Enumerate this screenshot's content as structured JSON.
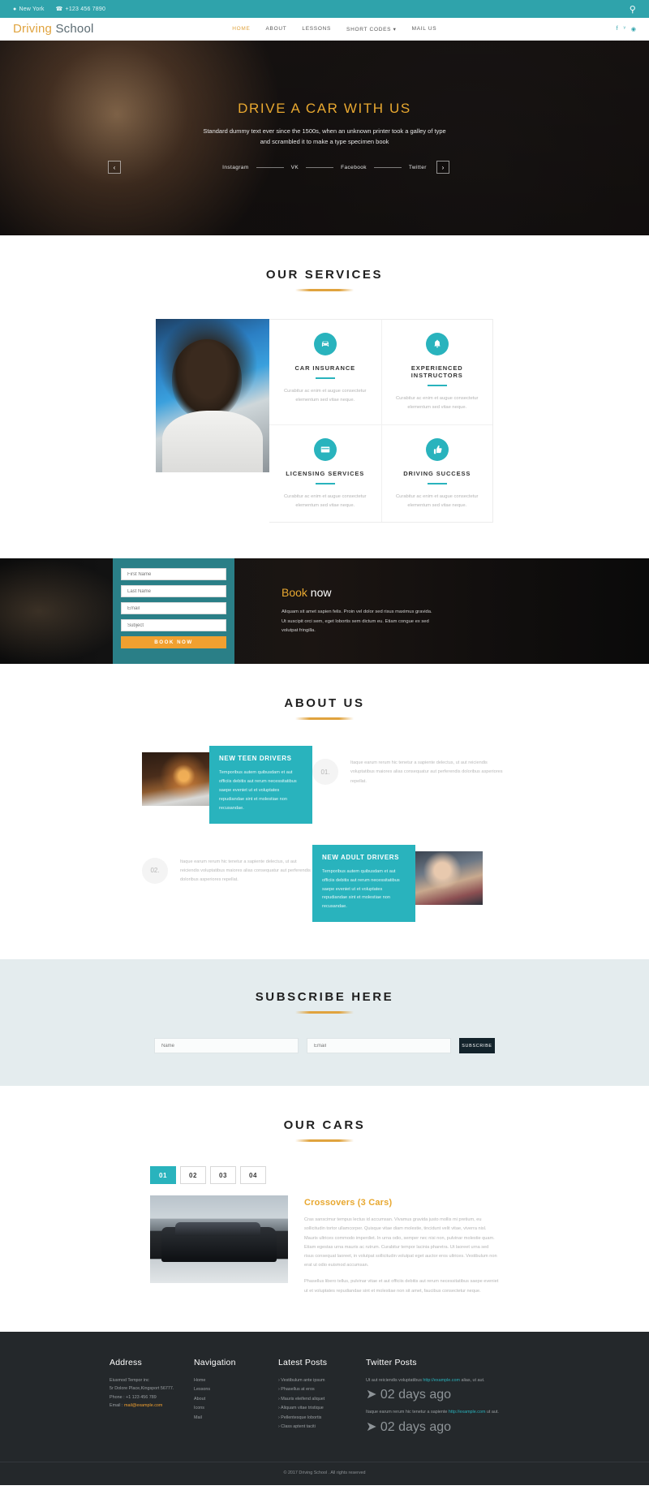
{
  "topbar": {
    "location": "New York",
    "phone": "+123 456 7890",
    "search_icon": "search-icon"
  },
  "header": {
    "logo_first": "Driving",
    "logo_second": "School",
    "nav": [
      {
        "label": "HOME",
        "active": true
      },
      {
        "label": "ABOUT",
        "active": false
      },
      {
        "label": "LESSONS",
        "active": false
      },
      {
        "label": "SHORT CODES ▾",
        "active": false
      },
      {
        "label": "MAIL US",
        "active": false
      }
    ],
    "social": [
      "f",
      "ᵛ",
      "◉"
    ]
  },
  "hero": {
    "title": "DRIVE A CAR WITH US",
    "subtitle": "Standard dummy text ever since the 1500s, when an unknown printer took a galley of type and scrambled it to make a type specimen book",
    "prev_icon": "‹",
    "next_icon": "›",
    "social": [
      "Instagram",
      "VK",
      "Facebook",
      "Twitter"
    ]
  },
  "services": {
    "title": "OUR SERVICES",
    "cards": [
      {
        "title": "CAR INSURANCE",
        "icon": "car-icon",
        "text": "Curabitur ac enim et augue consectetur elementum sed vitae neque."
      },
      {
        "title": "EXPERIENCED INSTRUCTORS",
        "icon": "bell-icon",
        "text": "Curabitur ac enim et augue consectetur elementum sed vitae neque."
      },
      {
        "title": "LICENSING SERVICES",
        "icon": "card-icon",
        "text": "Curabitur ac enim et augue consectetur elementum sed vitae neque."
      },
      {
        "title": "DRIVING SUCCESS",
        "icon": "thumbs-up-icon",
        "text": "Curabitur ac enim et augue consectetur elementum sed vitae neque."
      }
    ]
  },
  "booking": {
    "fields": [
      {
        "placeholder": "First Name",
        "value": ""
      },
      {
        "placeholder": "Last Name",
        "value": ""
      },
      {
        "placeholder": "Email",
        "value": ""
      },
      {
        "placeholder": "Subject",
        "value": ""
      }
    ],
    "button": "BOOK NOW",
    "heading_bold": "Book",
    "heading_light": " now",
    "text": "Aliquam sit amet sapien felis. Proin vel dolor sed risus maximus gravida. Ut suscipit orci sem, eget lobortis sem dictum eu. Etiam congue ex sed volutpat fringilla."
  },
  "about": {
    "title": "ABOUT US",
    "items": [
      {
        "heading": "NEW TEEN DRIVERS",
        "text": "Temporibus autem quibusdam et aut officiis debitis aut rerum necessitatibus saepe eveniet ut et voluptates repudiandae sint et molestiae non recusandae."
      },
      {
        "number": "01.",
        "text": "Itaque earum rerum hic tenetur a sapiente delectus, ut aut reiciendis voluptatibus maiores alias consequatur aut perferendis doloribus asperiores repellat."
      },
      {
        "number": "02.",
        "text": "Itaque earum rerum hic tenetur a sapiente delectus, ut aut reiciendis voluptatibus maiores alias consequatur aut perferendis doloribus asperiores repellat."
      },
      {
        "heading": "NEW ADULT DRIVERS",
        "text": "Temporibus autem quibusdam et aut officiis debitis aut rerum necessitatibus saepe eveniet ut et voluptates repudiandae sint et molestiae non recusandae."
      }
    ]
  },
  "subscribe": {
    "title": "SUBSCRIBE HERE",
    "name_placeholder": "Name",
    "email_placeholder": "Email",
    "button": "SUBSCRIBE"
  },
  "cars": {
    "title": "OUR CARS",
    "tabs": [
      {
        "label": "01",
        "active": true
      },
      {
        "label": "02",
        "active": false
      },
      {
        "label": "03",
        "active": false
      },
      {
        "label": "04",
        "active": false
      }
    ],
    "car_title": "Crossovers (3 Cars)",
    "para1": "Cras sanscimur tempus lectus id accumsan. Vivamus gravida justo mollis mi pretium, eu sollicitudin tortor ullamcorper. Quisque vitae diam molestie, tincidunt velit vitae, viverra nisl. Mauris ultrices commodo imperdiet. In urna odio, semper nec nisi non, pulvinar molestie quam. Etiam egestas urna mauris ac rutrum. Curabitur tempor lacinia pharetra. Ut laoreet urna sed risus consequat laoreet, in volutpat sollicitudin volutpat eget auctor eros ultrices. Vestibulum non erat ut odio euismod accumsan.",
    "para2": "Phasellus libero tellus, pulvinar vitae et aut officiis debitis aut rerum necessitatibus saepe eveniet ut et voluptates repudiandae sint et molestiae non sit amet, faucibus consectetur neque."
  },
  "footer": {
    "address": {
      "title": "Address",
      "company": "Eiusmod Tempor inc",
      "street": "5r Dolore Place,Kingsport 56777.",
      "phone_label": "Phone : ",
      "phone": "+1 123 456 789",
      "email_label": "Email : ",
      "email": "mail@example.com"
    },
    "navigation": {
      "title": "Navigation",
      "items": [
        "Home",
        "Lessons",
        "About",
        "Icons",
        "Mail"
      ]
    },
    "latest_posts": {
      "title": "Latest Posts",
      "items": [
        "Vestibulum ante ipsum",
        "Phasellus at eros",
        "Mauris eleifend aliquet",
        "Aliquam vitae tristique",
        "Pellentesque lobortis",
        "Class aptent taciti"
      ]
    },
    "twitter_posts": {
      "title": "Twitter Posts",
      "items": [
        {
          "text": "Ut aut reiciendis voluptatibus ",
          "link": "http://example.com",
          "tail": " alias, ut aut.",
          "date": "02 days ago"
        },
        {
          "text": "Itaque earum rerum hic tenetur a sapiente ",
          "link": "http://example.com",
          "tail": " ut aut.",
          "date": "02 days ago"
        }
      ]
    },
    "copyright": "© 2017 Driving School . All rights reserved"
  }
}
